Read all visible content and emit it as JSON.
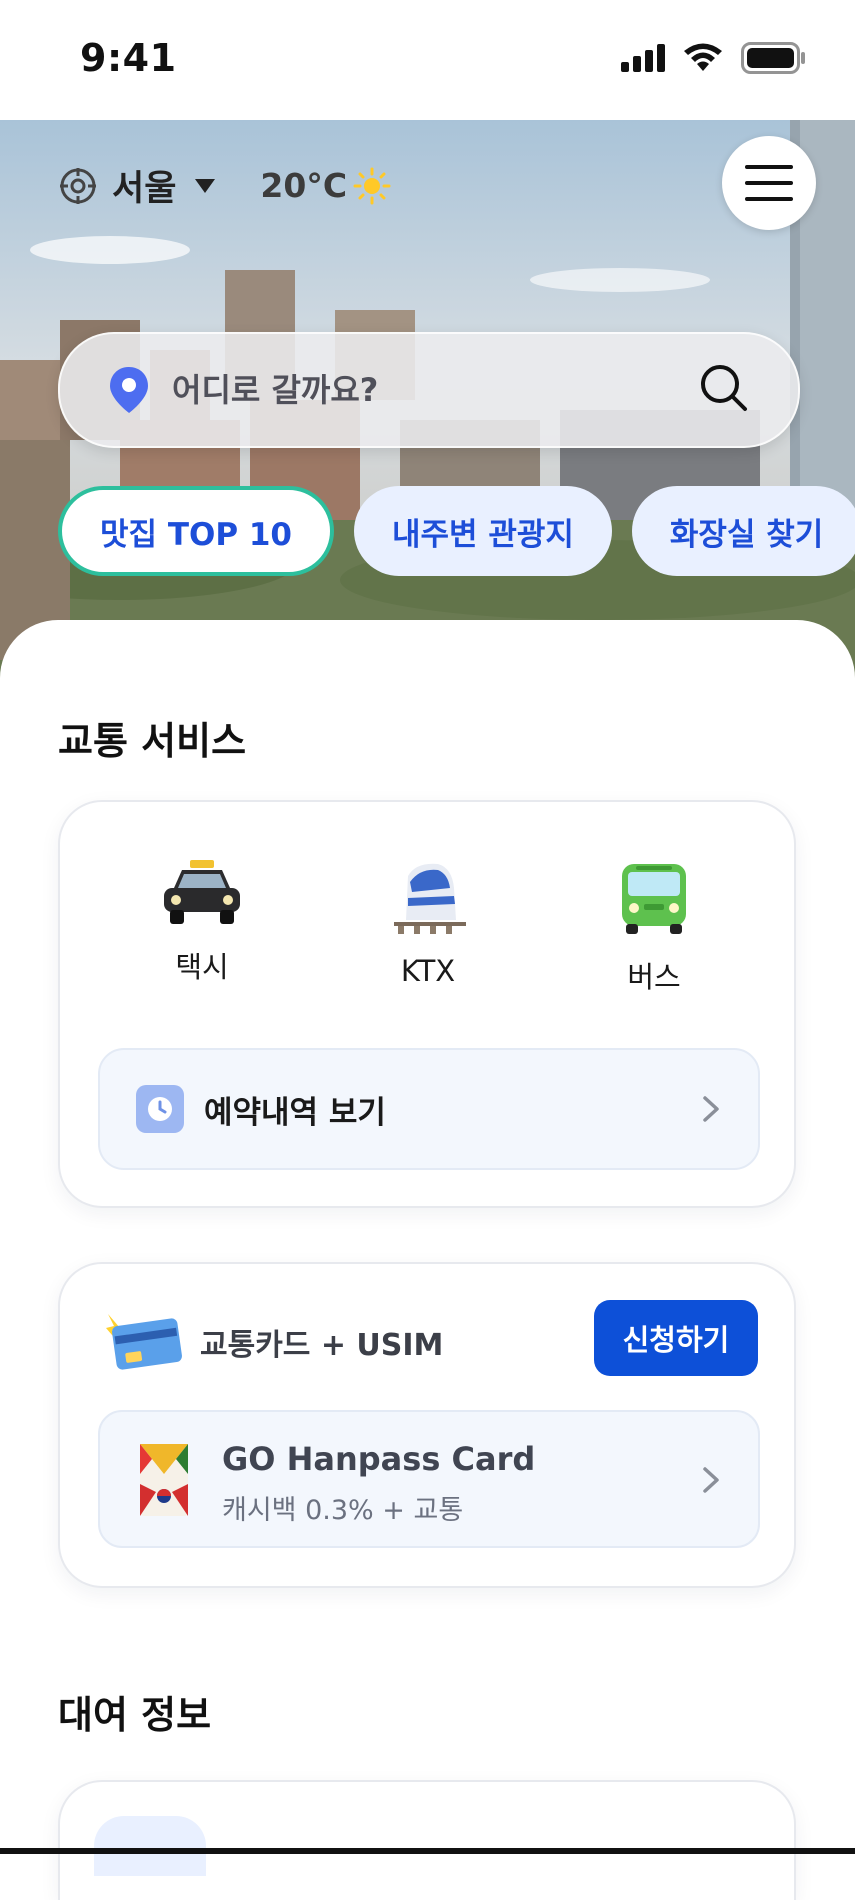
{
  "status_bar": {
    "time": "9:41"
  },
  "header": {
    "city": "서울",
    "temperature": "20°C",
    "weather_icon": "sun-icon"
  },
  "search": {
    "placeholder": "어디로 갈까요?"
  },
  "chips": [
    {
      "label": "맛집 TOP 10",
      "active": true
    },
    {
      "label": "내주변 관광지",
      "active": false
    },
    {
      "label": "화장실 찾기",
      "active": false
    }
  ],
  "transport_section": {
    "title": "교통 서비스",
    "items": [
      {
        "label": "택시",
        "icon": "taxi-icon"
      },
      {
        "label": "KTX",
        "icon": "train-icon"
      },
      {
        "label": "버스",
        "icon": "bus-icon"
      }
    ],
    "reservation_label": "예약내역 보기"
  },
  "card_section": {
    "title": "교통카드 + USIM",
    "apply_label": "신청하기",
    "card_name": "GO Hanpass Card",
    "card_desc": "캐시백 0.3% + 교통"
  },
  "rental_section": {
    "title": "대여 정보"
  },
  "colors": {
    "primary": "#0d50d8",
    "chip_bg": "#e9f0ff",
    "chip_active_border": "#2dbf9d"
  }
}
